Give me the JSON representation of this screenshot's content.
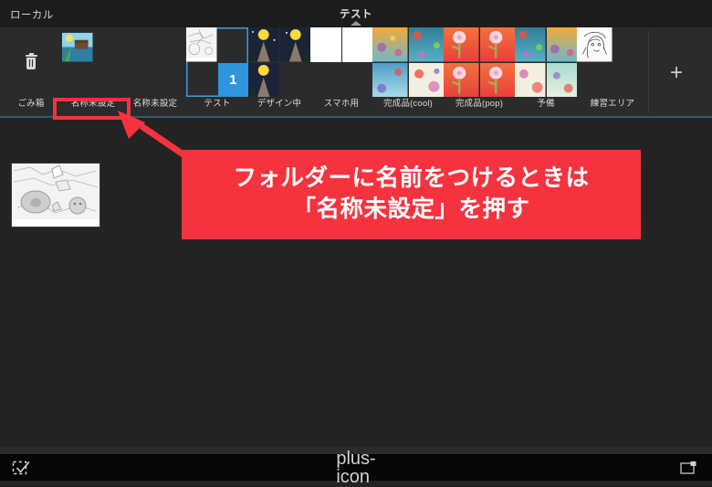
{
  "app": {
    "name": "ibisPaint-gallery",
    "theme": {
      "background": "#232323",
      "bar_background": "#2b2b2b",
      "title_background": "#1c1c1c",
      "accent_blue": "#2f95dd",
      "selection_blue": "#3d9ce0",
      "separator_blue": "#33586e",
      "annotation_red": "#f5333f",
      "text": "#dcdcdc"
    }
  },
  "titlebar": {
    "local_label": "ローカル",
    "current_folder": "テスト",
    "caret_icon": "caret-up-icon"
  },
  "folderbar": {
    "add_folder_label": "+",
    "folders": [
      {
        "label": "ごみ箱",
        "icon": "trash-icon",
        "selected": false,
        "kind": "trash",
        "count": 0
      },
      {
        "label": "名称未設定",
        "selected": false,
        "kind": "art",
        "count": 1,
        "highlighted": true
      },
      {
        "label": "名称未設定",
        "selected": false,
        "kind": "empty",
        "count": 0
      },
      {
        "label": "テスト",
        "selected": true,
        "kind": "sketch",
        "count": 1,
        "badge": "1"
      },
      {
        "label": "デザイン中",
        "selected": false,
        "kind": "night",
        "count": 3
      },
      {
        "label": "スマホ用",
        "selected": false,
        "kind": "blank",
        "count": 2
      },
      {
        "label": "完成品(cool)",
        "selected": false,
        "kind": "poster-cool",
        "count": 4
      },
      {
        "label": "完成品(pop)",
        "selected": false,
        "kind": "poster-pop",
        "count": 4
      },
      {
        "label": "予備",
        "selected": false,
        "kind": "poster-mix",
        "count": 4
      },
      {
        "label": "練習エリア",
        "selected": false,
        "kind": "lineart",
        "count": 1
      }
    ]
  },
  "main": {
    "canvas_items": [
      {
        "name": "sketch-canvas",
        "kind": "pencil-sketch"
      }
    ]
  },
  "bottombar": {
    "select_icon": "select-check-icon",
    "add_icon": "plus-icon",
    "import_icon": "import-image-icon"
  },
  "annotation": {
    "highlight_target": "名称未設定",
    "arrow_icon": "arrow-up-left-icon",
    "callout_line1": "フォルダーに名前をつけるときは",
    "callout_line2": "「名称未設定」を押す"
  }
}
